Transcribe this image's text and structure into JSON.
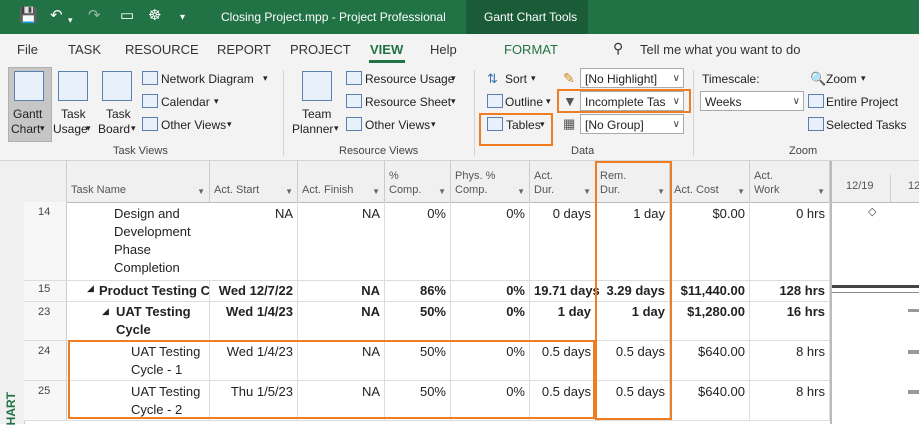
{
  "titlebar": {
    "doc_title": "Closing Project.mpp  -  Project Professional",
    "contextual": "Gantt Chart Tools",
    "bg": "#217346"
  },
  "tabs": [
    "File",
    "TASK",
    "RESOURCE",
    "REPORT",
    "PROJECT",
    "VIEW",
    "Help",
    "FORMAT"
  ],
  "active_tab": "VIEW",
  "tell_me": "Tell me what you want to do",
  "ribbon": {
    "task_views": {
      "gantt_l1": "Gantt",
      "gantt_l2": "Chart",
      "usage_l1": "Task",
      "usage_l2": "Usage",
      "board_l1": "Task",
      "board_l2": "Board",
      "network": "Network Diagram",
      "calendar": "Calendar",
      "other": "Other Views",
      "label": "Task Views"
    },
    "resource_views": {
      "planner_l1": "Team",
      "planner_l2": "Planner",
      "usage": "Resource Usage",
      "sheet": "Resource Sheet",
      "other": "Other Views",
      "label": "Resource Views"
    },
    "data": {
      "sort": "Sort",
      "outline": "Outline",
      "tables": "Tables",
      "highlight": "[No Highlight]",
      "filter": "Incomplete Tas",
      "group": "[No Group]",
      "label": "Data"
    },
    "zoom": {
      "timescale_label": "Timescale:",
      "timescale": "Weeks",
      "zoom": "Zoom",
      "entire": "Entire Project",
      "selected": "Selected Tasks",
      "label": "Zoom"
    }
  },
  "columns": [
    {
      "l1": "Task Name",
      "l2": ""
    },
    {
      "l1": "Act. Start",
      "l2": ""
    },
    {
      "l1": "Act. Finish",
      "l2": ""
    },
    {
      "l1": "%",
      "l2": "Comp."
    },
    {
      "l1": "Phys. %",
      "l2": "Comp."
    },
    {
      "l1": "Act.",
      "l2": "Dur."
    },
    {
      "l1": "Rem.",
      "l2": "Dur."
    },
    {
      "l1": "Act. Cost",
      "l2": ""
    },
    {
      "l1": "Act.",
      "l2": "Work"
    }
  ],
  "rows": [
    {
      "id": "14",
      "name_lines": [
        "Design and",
        "Development",
        "Phase",
        "Completion"
      ],
      "start": "NA",
      "finish": "NA",
      "pct": "0%",
      "phys": "0%",
      "actdur": "0 days",
      "remdur": "1 day",
      "cost": "$0.00",
      "work": "0 hrs"
    },
    {
      "id": "15",
      "name_lines": [
        "Product Testing C"
      ],
      "start": "Wed 12/7/22",
      "finish": "NA",
      "pct": "86%",
      "phys": "0%",
      "actdur": "19.71 days",
      "remdur": "3.29 days",
      "cost": "$11,440.00",
      "work": "128 hrs"
    },
    {
      "id": "23",
      "name_lines": [
        "UAT Testing",
        "Cycle"
      ],
      "start": "Wed 1/4/23",
      "finish": "NA",
      "pct": "50%",
      "phys": "0%",
      "actdur": "1 day",
      "remdur": "1 day",
      "cost": "$1,280.00",
      "work": "16 hrs"
    },
    {
      "id": "24",
      "name_lines": [
        "UAT Testing",
        "Cycle - 1"
      ],
      "start": "Wed 1/4/23",
      "finish": "NA",
      "pct": "50%",
      "phys": "0%",
      "actdur": "0.5 days",
      "remdur": "0.5 days",
      "cost": "$640.00",
      "work": "8 hrs"
    },
    {
      "id": "25",
      "name_lines": [
        "UAT Testing",
        "Cycle - 2"
      ],
      "start": "Thu 1/5/23",
      "finish": "NA",
      "pct": "50%",
      "phys": "0%",
      "actdur": "0.5 days",
      "remdur": "0.5 days",
      "cost": "$640.00",
      "work": "8 hrs"
    }
  ],
  "gantt": {
    "date1": "12/19",
    "date2": "12"
  },
  "sidebar_label": "HART",
  "highlight_color": "#f07d22"
}
